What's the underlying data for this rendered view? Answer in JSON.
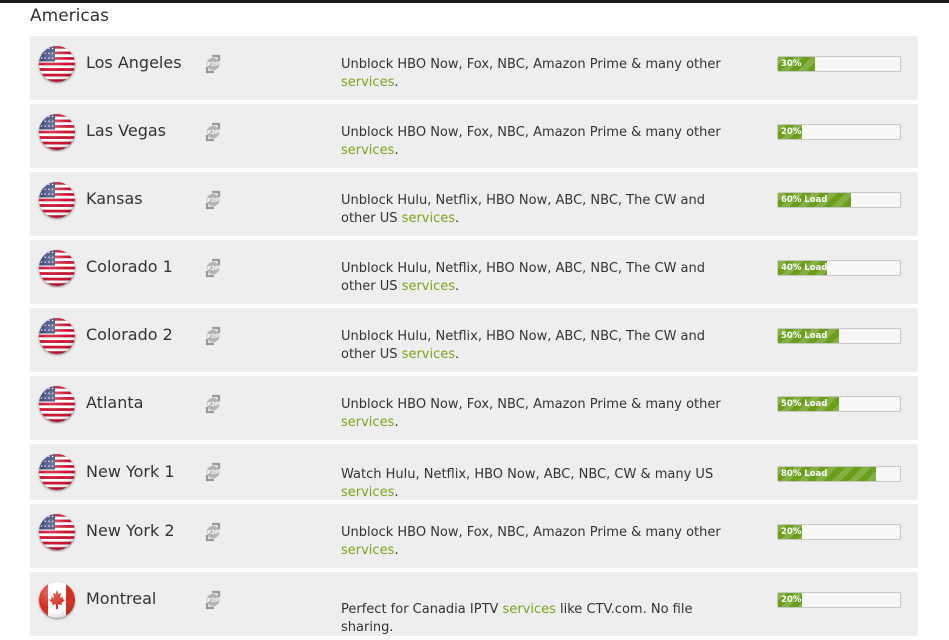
{
  "section": {
    "title": "Americas"
  },
  "servers": [
    {
      "city": "Los Angeles",
      "country": "us",
      "desc_pre": "Unblock HBO Now, Fox, NBC, Amazon Prime & many other",
      "link": "services",
      "desc_post": ".",
      "load_label": "30%",
      "load": 0.3
    },
    {
      "city": "Las Vegas",
      "country": "us",
      "desc_pre": "Unblock HBO Now, Fox, NBC, Amazon Prime & many other",
      "link": "services",
      "desc_post": ".",
      "load_label": "20%",
      "load": 0.2
    },
    {
      "city": "Kansas",
      "country": "us",
      "desc_pre": "Unblock Hulu, Netflix, HBO Now, ABC, NBC, The CW and other US",
      "link": "services",
      "desc_post": ".",
      "load_label": "60% Load",
      "load": 0.6
    },
    {
      "city": "Colorado 1",
      "country": "us",
      "desc_pre": "Unblock Hulu, Netflix, HBO Now, ABC, NBC, The CW and other US",
      "link": "services",
      "desc_post": ".",
      "load_label": "40% Load",
      "load": 0.4
    },
    {
      "city": "Colorado 2",
      "country": "us",
      "desc_pre": "Unblock Hulu, Netflix, HBO Now, ABC, NBC, The CW and other US",
      "link": "services",
      "desc_post": ".",
      "load_label": "50% Load",
      "load": 0.5
    },
    {
      "city": "Atlanta",
      "country": "us",
      "desc_pre": "Unblock HBO Now, Fox, NBC, Amazon Prime & many other",
      "link": "services",
      "desc_post": ".",
      "load_label": "50% Load",
      "load": 0.5
    },
    {
      "city": "New York 1",
      "country": "us",
      "desc_pre": "Watch Hulu, Netflix, HBO Now, ABC, NBC, CW & many US",
      "link": "services",
      "desc_post": ".",
      "load_label": "80% Load",
      "load": 0.8
    },
    {
      "city": "New York 2",
      "country": "us",
      "desc_pre": "Unblock HBO Now, Fox, NBC, Amazon Prime & many other",
      "link": "services",
      "desc_post": ".",
      "load_label": "20%",
      "load": 0.2
    },
    {
      "city": "Montreal",
      "country": "ca",
      "desc_pre": "Perfect for Canadia IPTV",
      "link": "services",
      "desc_post": "like CTV.com. No file sharing.",
      "load_label": "20%",
      "load": 0.2
    }
  ],
  "icons": {
    "flag_us": "us-flag-icon",
    "flag_ca": "canada-flag-icon",
    "p2p": "p2p-icon"
  },
  "colors": {
    "link": "#7aa51d",
    "load_fill": "#6b9e1b",
    "row_bg": "#eeeeee"
  }
}
